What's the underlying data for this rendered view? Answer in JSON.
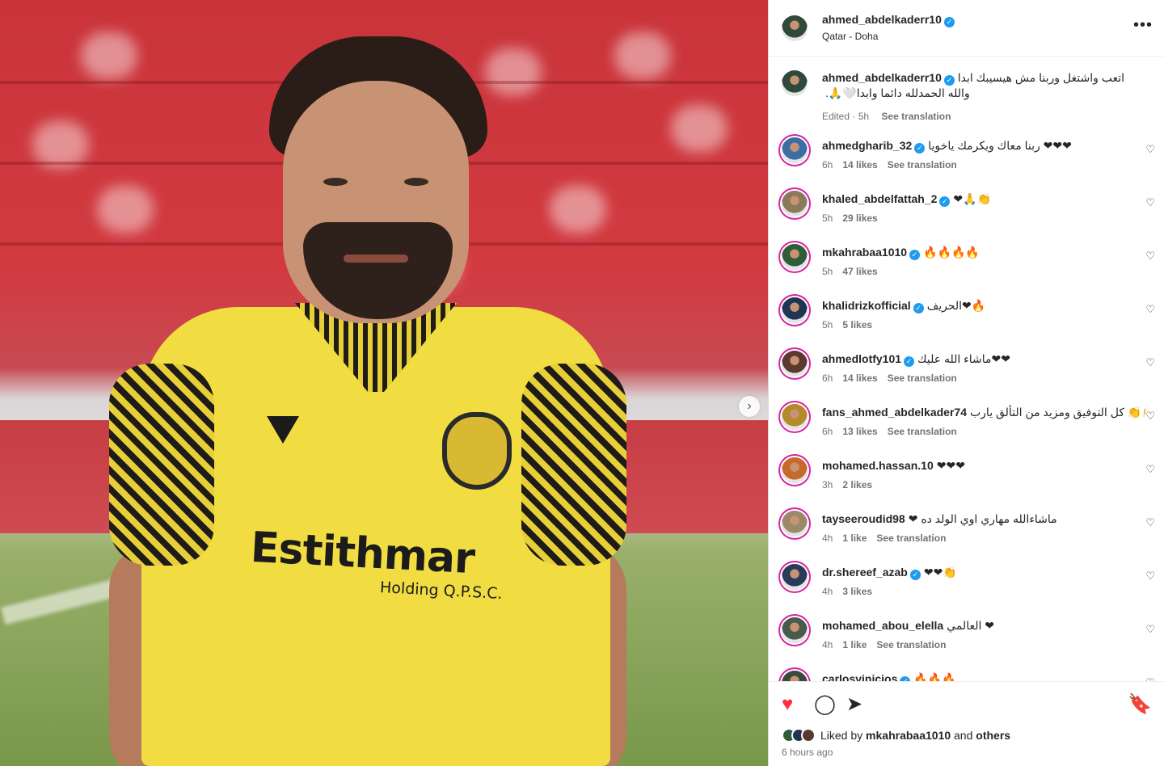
{
  "post": {
    "photo_sponsor": "Estithmar",
    "photo_sponsor_sub": "Holding Q.P.S.C."
  },
  "header": {
    "username": "ahmed_abdelkaderr10",
    "location": "Qatar - Doha",
    "more_label": "•••"
  },
  "caption": {
    "username": "ahmed_abdelkaderr10",
    "text": "اتعب واشتغل وربنا مش هيسيبك ابدا والله الحمدلله دائما وابدا🤍🙏.",
    "edited": "Edited · 5h",
    "translate": "See translation"
  },
  "comments": [
    {
      "username": "ahmedgharib_32",
      "verified": true,
      "text": "ربنا معاك ويكرمك ياخويا ❤❤❤",
      "time": "6h",
      "likes": "14 likes",
      "translate": "See translation",
      "avatar_color": "#3a6ea5"
    },
    {
      "username": "khaled_abdelfattah_2",
      "verified": true,
      "text": "❤🙏👏",
      "time": "5h",
      "likes": "29 likes",
      "translate": "",
      "avatar_color": "#8a7a5c"
    },
    {
      "username": "mkahrabaa1010",
      "verified": true,
      "text": "🔥🔥🔥🔥",
      "time": "5h",
      "likes": "47 likes",
      "translate": "",
      "avatar_color": "#2f5d3a"
    },
    {
      "username": "khalidrizkofficial",
      "verified": true,
      "text": "الحريف❤🔥",
      "time": "5h",
      "likes": "5 likes",
      "translate": "",
      "avatar_color": "#1f3552"
    },
    {
      "username": "ahmedlotfy101",
      "verified": true,
      "text": "ماشاء الله عليك❤❤",
      "time": "6h",
      "likes": "14 likes",
      "translate": "See translation",
      "avatar_color": "#5a3a2e"
    },
    {
      "username": "fans_ahmed_abdelkader74",
      "verified": false,
      "text": "كل التوفيق ومزيد من التألق يارب 👏👏👏",
      "time": "6h",
      "likes": "13 likes",
      "translate": "See translation",
      "avatar_color": "#b58a2a"
    },
    {
      "username": "mohamed.hassan.10",
      "verified": false,
      "text": "❤❤❤",
      "time": "3h",
      "likes": "2 likes",
      "translate": "",
      "avatar_color": "#c56a2a"
    },
    {
      "username": "tayseeroudid98",
      "verified": false,
      "text": "❤ ماشاءالله مهاري اوي الولد ده",
      "time": "4h",
      "likes": "1 like",
      "translate": "See translation",
      "avatar_color": "#9a8a6a"
    },
    {
      "username": "dr.shereef_azab",
      "verified": true,
      "text": "❤❤👏",
      "time": "4h",
      "likes": "3 likes",
      "translate": "",
      "avatar_color": "#2a3a5a"
    },
    {
      "username": "mohamed_abou_elella",
      "verified": false,
      "text": "العالمي ❤",
      "time": "4h",
      "likes": "1 like",
      "translate": "See translation",
      "avatar_color": "#4a5a4a"
    },
    {
      "username": "carlosvinicios",
      "verified": true,
      "text": "🔥🔥🔥",
      "time": "",
      "likes": "",
      "translate": "",
      "avatar_color": "#3a4a3a"
    }
  ],
  "footer": {
    "like_icon": "♥",
    "comment_icon": "◯",
    "share_icon": "➤",
    "save_icon": "🔖",
    "liked_by_prefix": "Liked by",
    "liked_by_user": "mkahrabaa1010",
    "liked_by_and": "and",
    "liked_by_others": "others",
    "time_ago": "6 hours ago"
  },
  "colors": {
    "like_red": "#ff3040",
    "verified_blue": "#1d9bf0",
    "story_ring": "#d6249f"
  }
}
